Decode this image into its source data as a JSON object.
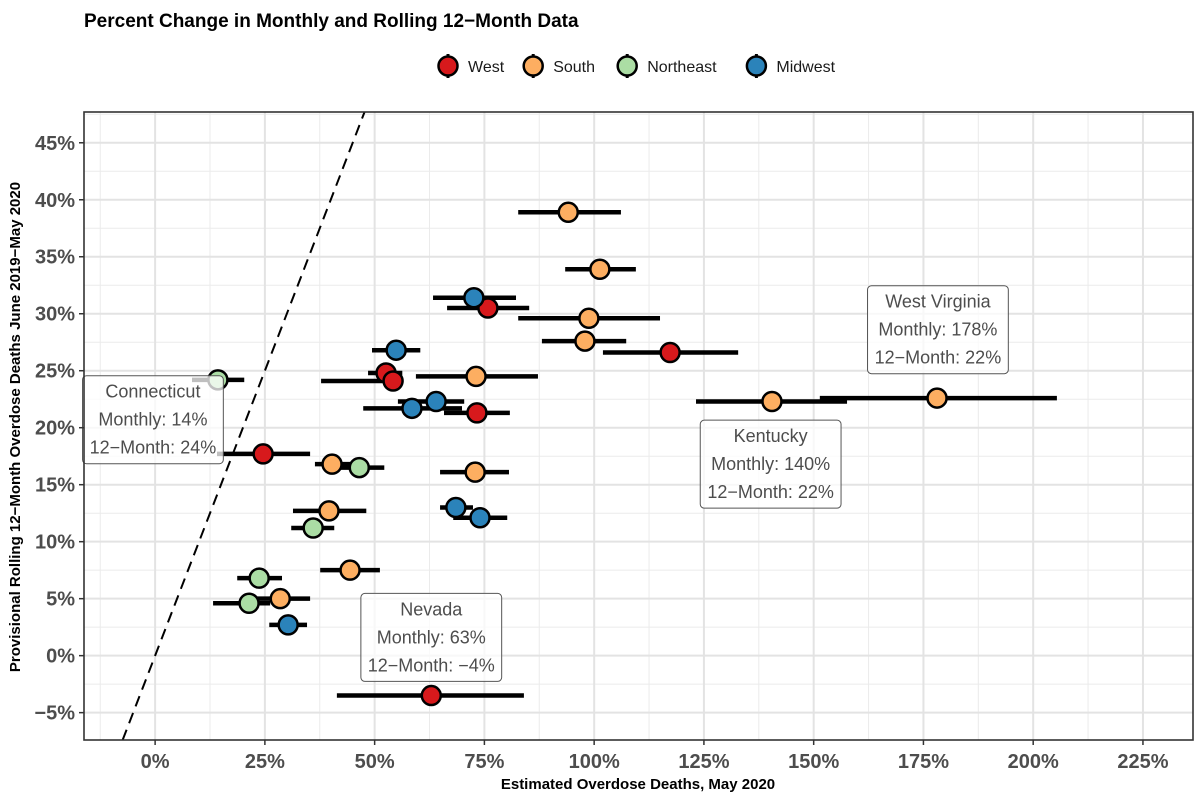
{
  "chart_data": {
    "type": "scatter",
    "title": "Percent Change in Monthly and Rolling 12−Month Data",
    "xlabel": "Estimated Overdose Deaths, May 2020",
    "ylabel": "Provisional Rolling 12−Month Overdose Deaths June 2019−May 2020",
    "xlim": [
      -16.2,
      236.4
    ],
    "ylim": [
      -7.4,
      47.7
    ],
    "x_ticks": [
      0,
      25,
      50,
      75,
      100,
      125,
      150,
      175,
      200,
      225
    ],
    "x_tick_labels": [
      "0%",
      "25%",
      "50%",
      "75%",
      "100%",
      "125%",
      "150%",
      "175%",
      "200%",
      "225%"
    ],
    "y_ticks": [
      -5,
      0,
      5,
      10,
      15,
      20,
      25,
      30,
      35,
      40,
      45
    ],
    "y_tick_labels": [
      "−5%",
      "0%",
      "5%",
      "10%",
      "15%",
      "20%",
      "25%",
      "30%",
      "35%",
      "40%",
      "45%"
    ],
    "grid": true,
    "reference_line": {
      "type": "identity",
      "style": "dashed",
      "description": "y = x"
    },
    "legend": {
      "placement": "top",
      "entries": [
        {
          "name": "West",
          "color": "#d7191c"
        },
        {
          "name": "South",
          "color": "#fdae61"
        },
        {
          "name": "Northeast",
          "color": "#abdda4"
        },
        {
          "name": "Midwest",
          "color": "#2b83ba"
        }
      ]
    },
    "series": [
      {
        "name": "West",
        "color": "#d7191c",
        "points": [
          {
            "x": 75.8,
            "x_low": 66.5,
            "x_high": 85.2,
            "y": 30.5
          },
          {
            "x": 117.3,
            "x_low": 102.0,
            "x_high": 132.8,
            "y": 26.6
          },
          {
            "x": 52.6,
            "x_low": 48.5,
            "x_high": 56.3,
            "y": 24.8
          },
          {
            "x": 54.2,
            "x_low": 37.8,
            "x_high": 56.5,
            "y": 24.1
          },
          {
            "x": 73.3,
            "x_low": 65.8,
            "x_high": 80.8,
            "y": 21.3
          },
          {
            "x": 24.6,
            "x_low": 14.1,
            "x_high": 35.3,
            "y": 17.7
          },
          {
            "x": 62.9,
            "x_low": 41.4,
            "x_high": 84.0,
            "y": -3.5,
            "label": "Nevada"
          }
        ]
      },
      {
        "name": "South",
        "color": "#fdae61",
        "points": [
          {
            "x": 94.1,
            "x_low": 82.7,
            "x_high": 106.1,
            "y": 38.9
          },
          {
            "x": 101.3,
            "x_low": 93.4,
            "x_high": 109.5,
            "y": 33.9
          },
          {
            "x": 98.8,
            "x_low": 82.7,
            "x_high": 115.0,
            "y": 29.6
          },
          {
            "x": 97.9,
            "x_low": 88.1,
            "x_high": 107.3,
            "y": 27.6
          },
          {
            "x": 73.1,
            "x_low": 59.4,
            "x_high": 87.2,
            "y": 24.5
          },
          {
            "x": 140.5,
            "x_low": 123.2,
            "x_high": 157.6,
            "y": 22.3,
            "label": "Kentucky"
          },
          {
            "x": 178.1,
            "x_low": 151.4,
            "x_high": 205.4,
            "y": 22.6,
            "label": "West Virginia"
          },
          {
            "x": 40.3,
            "x_low": 36.4,
            "x_high": 44.9,
            "y": 16.8
          },
          {
            "x": 72.9,
            "x_low": 64.9,
            "x_high": 80.6,
            "y": 16.1
          },
          {
            "x": 39.6,
            "x_low": 31.4,
            "x_high": 48.1,
            "y": 12.7
          },
          {
            "x": 44.4,
            "x_low": 37.6,
            "x_high": 51.2,
            "y": 7.5
          },
          {
            "x": 28.5,
            "x_low": 21.0,
            "x_high": 35.3,
            "y": 5.0
          }
        ]
      },
      {
        "name": "Northeast",
        "color": "#abdda4",
        "points": [
          {
            "x": 14.3,
            "x_low": 8.4,
            "x_high": 20.3,
            "y": 24.2,
            "label": "Connecticut"
          },
          {
            "x": 46.5,
            "x_low": 40.5,
            "x_high": 52.2,
            "y": 16.5
          },
          {
            "x": 36.0,
            "x_low": 31.0,
            "x_high": 40.8,
            "y": 11.2
          },
          {
            "x": 23.7,
            "x_low": 18.7,
            "x_high": 28.9,
            "y": 6.8
          },
          {
            "x": 21.4,
            "x_low": 13.2,
            "x_high": 26.2,
            "y": 4.6
          }
        ]
      },
      {
        "name": "Midwest",
        "color": "#2b83ba",
        "points": [
          {
            "x": 72.6,
            "x_low": 63.3,
            "x_high": 82.2,
            "y": 31.4
          },
          {
            "x": 54.9,
            "x_low": 49.4,
            "x_high": 60.4,
            "y": 26.8
          },
          {
            "x": 64.0,
            "x_low": 55.3,
            "x_high": 70.4,
            "y": 22.3
          },
          {
            "x": 58.5,
            "x_low": 47.4,
            "x_high": 69.9,
            "y": 21.7
          },
          {
            "x": 68.5,
            "x_low": 64.9,
            "x_high": 72.4,
            "y": 13.0
          },
          {
            "x": 74.0,
            "x_low": 67.9,
            "x_high": 80.2,
            "y": 12.1
          },
          {
            "x": 30.3,
            "x_low": 26.0,
            "x_high": 34.6,
            "y": 2.7
          }
        ]
      }
    ],
    "annotations": [
      {
        "state": "Connecticut",
        "lines": [
          "Connecticut",
          "Monthly: 14%",
          "12−Month: 24%"
        ],
        "anchor_x": -0.5,
        "anchor_y": 20.7
      },
      {
        "state": "Nevada",
        "lines": [
          "Nevada",
          "Monthly: 63%",
          "12−Month: −4%"
        ],
        "anchor_x": 62.9,
        "anchor_y": 1.6
      },
      {
        "state": "Kentucky",
        "lines": [
          "Kentucky",
          "Monthly: 140%",
          "12−Month: 22%"
        ],
        "anchor_x": 140.2,
        "anchor_y": 16.8
      },
      {
        "state": "West Virginia",
        "lines": [
          "West Virginia",
          "Monthly: 178%",
          "12−Month: 22%"
        ],
        "anchor_x": 178.3,
        "anchor_y": 28.6
      }
    ]
  }
}
